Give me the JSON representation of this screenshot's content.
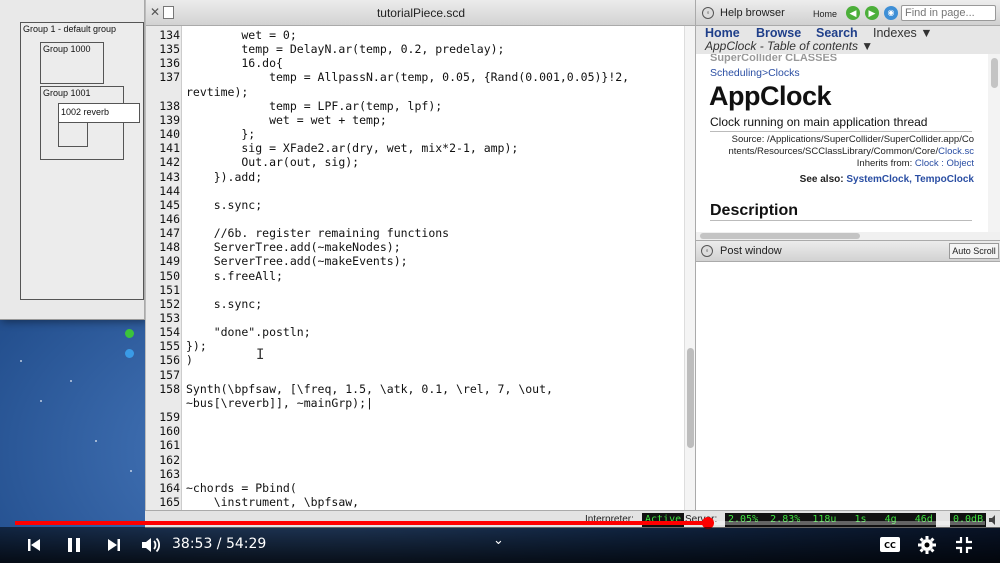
{
  "node_tree": {
    "group1": "Group 1 - default group",
    "group1000": "Group 1000",
    "group1001": "Group 1001",
    "synth": "1002 reverb"
  },
  "editor": {
    "tab_title": "tutorialPiece.scd",
    "lines": [
      {
        "num": "134",
        "code": "        wet = 0;"
      },
      {
        "num": "135",
        "code": "        temp = DelayN.ar(temp, 0.2, predelay);"
      },
      {
        "num": "136",
        "code": "        16.do{"
      },
      {
        "num": "137",
        "code": "            temp = AllpassN.ar(temp, 0.05, {Rand(0.001,0.05)}!2,"
      },
      {
        "num": "",
        "code": "revtime);"
      },
      {
        "num": "138",
        "code": "            temp = LPF.ar(temp, lpf);"
      },
      {
        "num": "139",
        "code": "            wet = wet + temp;"
      },
      {
        "num": "140",
        "code": "        };"
      },
      {
        "num": "141",
        "code": "        sig = XFade2.ar(dry, wet, mix*2-1, amp);"
      },
      {
        "num": "142",
        "code": "        Out.ar(out, sig);"
      },
      {
        "num": "143",
        "code": "    }).add;"
      },
      {
        "num": "144",
        "code": ""
      },
      {
        "num": "145",
        "code": "    s.sync;"
      },
      {
        "num": "146",
        "code": ""
      },
      {
        "num": "147",
        "code": "    //6b. register remaining functions"
      },
      {
        "num": "148",
        "code": "    ServerTree.add(~makeNodes);"
      },
      {
        "num": "149",
        "code": "    ServerTree.add(~makeEvents);"
      },
      {
        "num": "150",
        "code": "    s.freeAll;"
      },
      {
        "num": "151",
        "code": ""
      },
      {
        "num": "152",
        "code": "    s.sync;"
      },
      {
        "num": "153",
        "code": ""
      },
      {
        "num": "154",
        "code": "    \"done\".postln;"
      },
      {
        "num": "155",
        "code": "});"
      },
      {
        "num": "156",
        "code": ")"
      },
      {
        "num": "157",
        "code": ""
      },
      {
        "num": "158",
        "code": "Synth(\\bpfsaw, [\\freq, 1.5, \\atk, 0.1, \\rel, 7, \\out,"
      },
      {
        "num": "",
        "code": "~bus[\\reverb]], ~mainGrp);|"
      },
      {
        "num": "159",
        "code": ""
      },
      {
        "num": "160",
        "code": ""
      },
      {
        "num": "161",
        "code": ""
      },
      {
        "num": "162",
        "code": ""
      },
      {
        "num": "163",
        "code": ""
      },
      {
        "num": "164",
        "code": "~chords = Pbind("
      },
      {
        "num": "165",
        "code": "    \\instrument, \\bpfsaw,"
      }
    ]
  },
  "help": {
    "title": "Help browser",
    "home_small": "Home",
    "find_placeholder": "Find in page...",
    "nav_home": "Home",
    "nav_browse": "Browse",
    "nav_search": "Search",
    "nav_indexes": "Indexes ▼",
    "toc": "AppClock - Table of contents ▼",
    "sc_classes": "SuperCollider CLASSES",
    "scheduling": "Scheduling>Clocks",
    "class_name": "AppClock",
    "summary": "Clock running on main application thread",
    "source_line1": "Source: /Applications/SuperCollider/SuperCollider.app/Co",
    "source_line2_pre": "ntents/Resources/SCClassLibrary/Common/Core/",
    "source_line2_link": "Clock.sc",
    "inherits_pre": "Inherits from: ",
    "inherits_link": "Clock : Object",
    "see_also_pre": "See also: ",
    "see_also_link": "SystemClock, TempoClock",
    "description": "Description"
  },
  "post": {
    "title": "Post window",
    "auto_scroll": "Auto Scroll"
  },
  "status": {
    "interpreter_label": "Interpreter:",
    "interpreter_value": "Active",
    "server_label": "Server:",
    "avg_cpu": "2.05%",
    "peak_cpu": "2.83%",
    "ugens": "118u",
    "synths": "1s",
    "groups": "4g",
    "synthdefs": "46d",
    "volume": "0.0dB"
  },
  "player": {
    "time": "38:53 / 54:29",
    "progress": 0.714,
    "accent": "#ff0000"
  }
}
